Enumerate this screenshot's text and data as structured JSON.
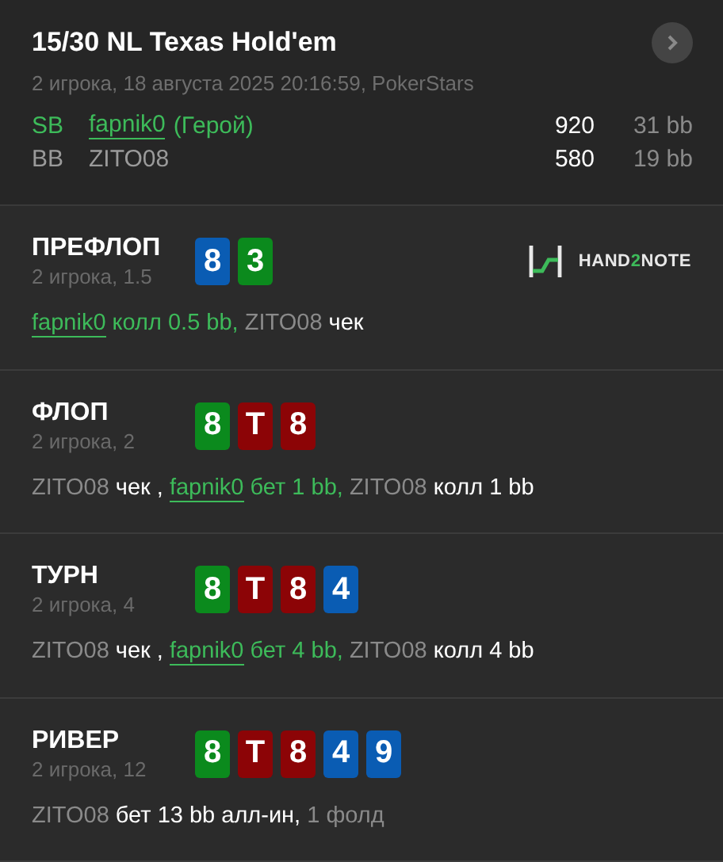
{
  "header": {
    "title": "15/30 NL Texas Hold'em",
    "subtitle": "2 игрока, 18 августа 2025 20:16:59, PokerStars",
    "players": [
      {
        "position": "SB",
        "name": "fapnik0",
        "hero": true,
        "hero_label": "(Герой)",
        "stack": "920",
        "bb": "31 bb"
      },
      {
        "position": "BB",
        "name": "ZITO08",
        "hero": false,
        "stack": "580",
        "bb": "19 bb"
      }
    ]
  },
  "streets": [
    {
      "name": "ПРЕФЛОП",
      "info": "2 игрока, 1.5",
      "logo": [
        {
          "text": "HAND",
          "accent": false
        },
        {
          "text": "2",
          "accent": true
        },
        {
          "text": "NOTE",
          "accent": false
        }
      ],
      "cards": [
        {
          "rank": "8",
          "color": "#0a5cb3"
        },
        {
          "rank": "3",
          "color": "#0b8a1d"
        }
      ],
      "actions": [
        {
          "text": "fapnik0",
          "kind": "hero-link"
        },
        {
          "text": " колл 0.5 bb,",
          "kind": "hero"
        },
        {
          "text": " ZITO08",
          "kind": "muted"
        },
        {
          "text": " чек",
          "kind": "action"
        }
      ]
    },
    {
      "name": "ФЛОП",
      "info": "2 игрока, 2",
      "cards": [
        {
          "rank": "8",
          "color": "#0b8a1d"
        },
        {
          "rank": "T",
          "color": "#8c0406"
        },
        {
          "rank": "8",
          "color": "#8c0406"
        }
      ],
      "actions": [
        {
          "text": "ZITO08",
          "kind": "muted"
        },
        {
          "text": " чек , ",
          "kind": "action"
        },
        {
          "text": "fapnik0",
          "kind": "hero-link"
        },
        {
          "text": " бет 1 bb,",
          "kind": "hero"
        },
        {
          "text": " ZITO08",
          "kind": "muted"
        },
        {
          "text": " колл 1 bb",
          "kind": "action"
        }
      ]
    },
    {
      "name": "ТУРН",
      "info": "2 игрока, 4",
      "cards": [
        {
          "rank": "8",
          "color": "#0b8a1d"
        },
        {
          "rank": "T",
          "color": "#8c0406"
        },
        {
          "rank": "8",
          "color": "#8c0406"
        },
        {
          "rank": "4",
          "color": "#0a5cb3"
        }
      ],
      "actions": [
        {
          "text": "ZITO08",
          "kind": "muted"
        },
        {
          "text": " чек , ",
          "kind": "action"
        },
        {
          "text": "fapnik0",
          "kind": "hero-link"
        },
        {
          "text": " бет 4 bb,",
          "kind": "hero"
        },
        {
          "text": " ZITO08",
          "kind": "muted"
        },
        {
          "text": " колл 4 bb",
          "kind": "action"
        }
      ]
    },
    {
      "name": "РИВЕР",
      "info": "2 игрока, 12",
      "cards": [
        {
          "rank": "8",
          "color": "#0b8a1d"
        },
        {
          "rank": "T",
          "color": "#8c0406"
        },
        {
          "rank": "8",
          "color": "#8c0406"
        },
        {
          "rank": "4",
          "color": "#0a5cb3"
        },
        {
          "rank": "9",
          "color": "#0a5cb3"
        }
      ],
      "actions": [
        {
          "text": "ZITO08",
          "kind": "muted"
        },
        {
          "text": " бет 13 bb алл-ин,",
          "kind": "action"
        },
        {
          "text": " 1 фолд",
          "kind": "muted"
        }
      ]
    }
  ]
}
